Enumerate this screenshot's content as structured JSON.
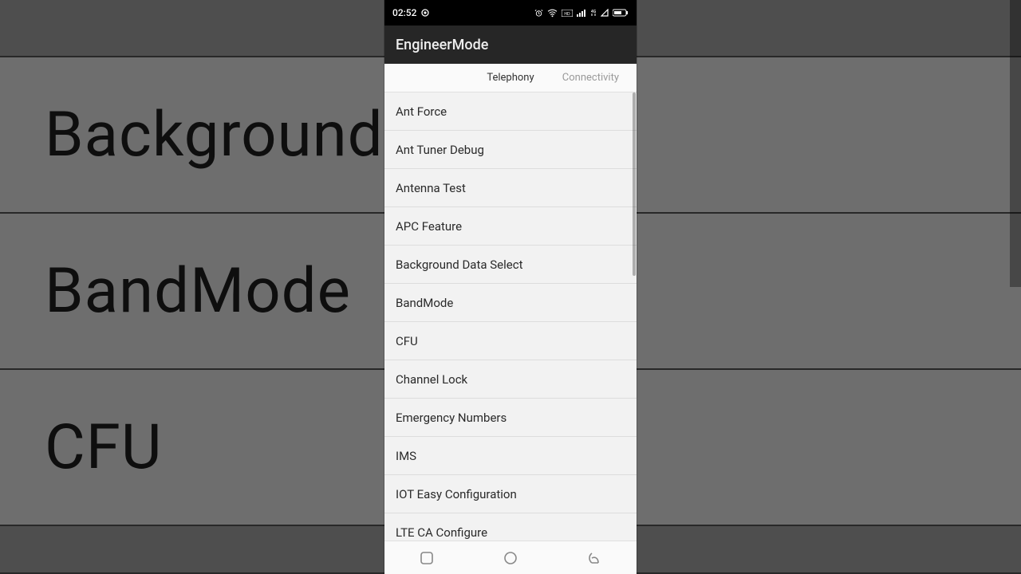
{
  "status": {
    "time": "02:52"
  },
  "app": {
    "title": "EngineerMode"
  },
  "tabs": {
    "active": "Telephony",
    "next": "Connectivity"
  },
  "items": [
    "Ant Force",
    "Ant Tuner Debug",
    "Antenna Test",
    "APC Feature",
    "Background Data Select",
    "BandMode",
    "CFU",
    "Channel Lock",
    "Emergency Numbers",
    "IMS",
    "IOT Easy Configuration",
    "LTE CA Configure"
  ],
  "bg": {
    "row1": "Background Data",
    "row2": "BandMode",
    "row3": "CFU"
  }
}
